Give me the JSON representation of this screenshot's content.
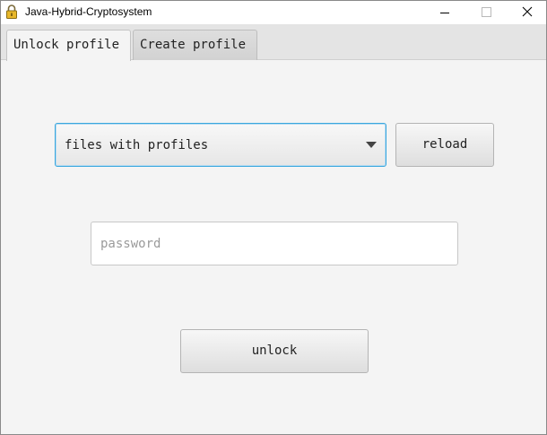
{
  "window": {
    "title": "Java-Hybrid-Cryptosystem",
    "app_icon": "padlock-icon",
    "controls": [
      "minimize-icon",
      "maximize-icon",
      "close-icon"
    ]
  },
  "tabs": [
    {
      "label": "Unlock profile",
      "selected": true
    },
    {
      "label": "Create profile",
      "selected": false
    }
  ],
  "unlock_tab": {
    "profile_select": {
      "selected_value": "files with profiles"
    },
    "reload_label": "reload",
    "password": {
      "value": "",
      "placeholder": "password"
    },
    "unlock_label": "unlock"
  },
  "colors": {
    "focus_border": "#3aa7de",
    "background": "#f4f4f4",
    "padlock": "#e8b82a"
  }
}
